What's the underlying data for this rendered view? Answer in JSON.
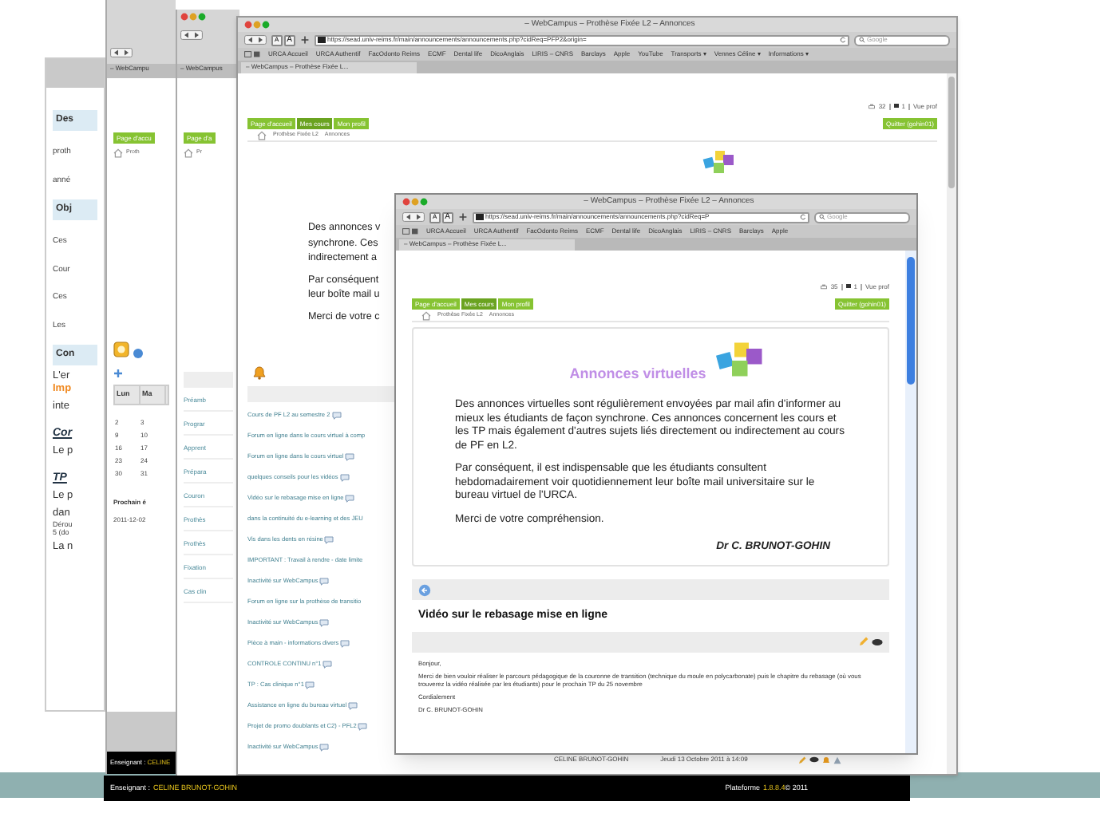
{
  "window_1": {
    "lines": [
      {
        "kind": "heading",
        "text": "Des"
      },
      {
        "kind": "text",
        "text": "proth"
      },
      {
        "kind": "text",
        "text": "anné"
      },
      {
        "kind": "heading",
        "text": "Obj"
      },
      {
        "kind": "text",
        "text": "Ces"
      },
      {
        "kind": "text",
        "text": "Cour"
      },
      {
        "kind": "text",
        "text": "Ces"
      },
      {
        "kind": "text",
        "text": "Les"
      },
      {
        "kind": "heading",
        "text": "Con"
      },
      {
        "kind": "large",
        "text": "L'er"
      },
      {
        "kind": "highlight",
        "text": "Imp"
      },
      {
        "kind": "large",
        "text": "inte"
      },
      {
        "kind": "subheading",
        "text": "Cor"
      },
      {
        "kind": "large",
        "text": "Le p"
      },
      {
        "kind": "subheading",
        "text": "TP"
      },
      {
        "kind": "large",
        "text": "Le p"
      },
      {
        "kind": "large",
        "text": "dan"
      },
      {
        "kind": "small",
        "text": "Dérou"
      },
      {
        "kind": "small",
        "text": "5 (do"
      },
      {
        "kind": "large",
        "text": "La n"
      }
    ]
  },
  "window_2": {
    "tab": "– WebCampu",
    "nav_button": "Page d'accu",
    "crumb": "Proth",
    "calendar": {
      "headers": [
        "Lun",
        "Ma"
      ],
      "rows": [
        [
          "2",
          "3"
        ],
        [
          "9",
          "10"
        ],
        [
          "16",
          "17"
        ],
        [
          "23",
          "24"
        ],
        [
          "30",
          "31"
        ]
      ]
    },
    "next_label": "Prochain é",
    "next_date": "2011-12-02",
    "footer_label": "Enseignant :",
    "footer_name": "CELINE"
  },
  "window_3": {
    "tab": "– WebCampus",
    "nav_button": "Page d'a",
    "crumb": "Pr",
    "items": [
      "Préamb",
      "Prograr",
      "Apprent",
      "Prépara",
      "Couron",
      "Prothès",
      "Prothès",
      "Fixation",
      "Cas clin"
    ]
  },
  "window_4": {
    "title": "– WebCampus – Prothèse Fixée L2 – Annonces",
    "text_size_buttons": [
      "A",
      "A"
    ],
    "url": "https://sead.univ-reims.fr/main/announcements/announcements.php?cidReq=PFP2&origin=",
    "search_placeholder": "Google",
    "bookmarks": [
      "URCA Accueil",
      "URCA Authentif",
      "FacOdonto Reims",
      "ECMF",
      "Dental life",
      "DicoAnglais",
      "LIRIS – CNRS",
      "Barclays",
      "Apple",
      "YouTube",
      "Transports ▾",
      "Vennes Céline ▾",
      "Informations ▾"
    ],
    "tab": "– WebCampus – Prothèse Fixée L...",
    "stats": {
      "prints": "32",
      "messages": "1",
      "view": "Vue prof"
    },
    "nav_buttons": [
      "Page d'accueil",
      "Mes cours",
      "Mon profil"
    ],
    "quit_button": "Quitter (gohin01)",
    "breadcrumb": [
      "Prothèse Fixée L2",
      "Annonces"
    ],
    "intro_fragments": [
      "Des annonces v",
      "synchrone. Ces",
      "indirectement a",
      "Par conséquent",
      "leur boîte mail u",
      "Merci de votre c"
    ],
    "announcements": [
      {
        "title": "Cours de PF L2 au semestre 2",
        "icon": true
      },
      {
        "title": "Forum en ligne dans le cours virtuel à comp",
        "icon": false
      },
      {
        "title": "Forum en ligne dans le cours virtuel",
        "icon": true
      },
      {
        "title": "quelques conseils pour les vidéos",
        "icon": true
      },
      {
        "title": "Vidéo sur le rebasage mise en ligne",
        "icon": true
      },
      {
        "title": "dans la continuité du e-learning et des JEU",
        "icon": false
      },
      {
        "title": "Vis dans les dents en résine",
        "icon": true
      },
      {
        "title": "IMPORTANT : Travail à rendre - date limite",
        "icon": false
      },
      {
        "title": "Inactivité sur WebCampus",
        "icon": true
      },
      {
        "title": "Forum en ligne sur la prothèse de transitio",
        "icon": false
      },
      {
        "title": "Inactivité sur WebCampus",
        "icon": true
      },
      {
        "title": "Pièce à main - informations divers",
        "icon": true
      },
      {
        "title": "CONTROLE CONTINU n°1",
        "icon": true
      },
      {
        "title": "TP : Cas clinique n°1",
        "icon": true
      },
      {
        "title": "Assistance en ligne du bureau virtuel",
        "icon": true
      },
      {
        "title": "Projet de promo doublants et C2) - PFL2",
        "icon": true
      },
      {
        "title": "Inactivité sur WebCampus",
        "icon": true
      }
    ],
    "author": "CELINE BRUNOT-GOHIN",
    "date": "Jeudi 13 Octobre 2011 à 14:09"
  },
  "window_5": {
    "title": "– WebCampus – Prothèse Fixée L2 – Annonces",
    "text_size_buttons": [
      "A",
      "A"
    ],
    "url": "https://sead.univ-reims.fr/main/announcements/announcements.php?cidReq=P",
    "search_placeholder": "Google",
    "bookmarks": [
      "URCA Accueil",
      "URCA Authentif",
      "FacOdonto Reims",
      "ECMF",
      "Dental life",
      "DicoAnglais",
      "LIRIS – CNRS",
      "Barclays",
      "Apple"
    ],
    "tab": "– WebCampus – Prothèse Fixée L...",
    "stats": {
      "prints": "35",
      "messages": "1",
      "view": "Vue prof"
    },
    "nav_buttons": [
      "Page d'accueil",
      "Mes cours",
      "Mon profil"
    ],
    "quit_button": "Quitter (gohin01)",
    "breadcrumb": [
      "Prothèse Fixée L2",
      "Annonces"
    ],
    "card": {
      "title": "Annonces virtuelles",
      "paragraphs": [
        "Des annonces virtuelles sont régulièrement envoyées par mail afin d'informer au mieux les étudiants de façon synchrone. Ces annonces concernent les cours et les TP mais également d'autres sujets liés directement ou indirectement au cours de PF en L2.",
        "Par conséquent, il est indispensable que les étudiants consultent hebdomadairement voir quotidiennement leur boîte mail universitaire sur le bureau virtuel de l'URCA.",
        "Merci de votre compréhension."
      ],
      "signature": "Dr C. BRUNOT-GOHIN"
    },
    "message": {
      "title": "Vidéo sur le rebasage mise en ligne",
      "lines": [
        "Bonjour,",
        "Merci de bien vouloir réaliser le parcours pédagogique de la couronne de transition (technique du moule en polycarbonate) puis le chapitre du rebasage (où vous trouverez la vidéo réalisée par les étudiants) pour le prochain TP du 25 novembre",
        "Cordialement",
        "Dr C. BRUNOT-GOHIN"
      ]
    }
  },
  "footer": {
    "label": "Enseignant :",
    "name": "CELINE BRUNOT-GOHIN",
    "platform": "Plateforme",
    "version": "1.8.8.4",
    "year": "© 2011"
  }
}
